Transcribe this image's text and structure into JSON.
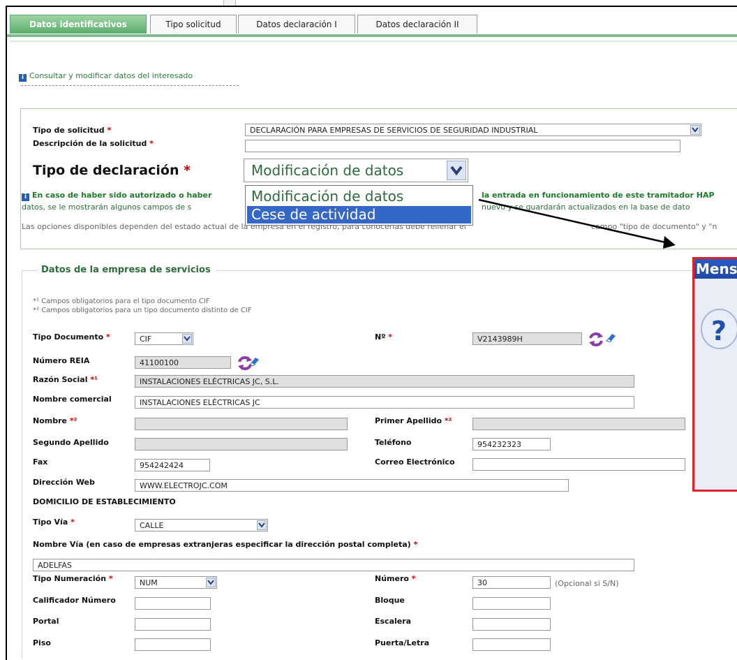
{
  "tabs": [
    {
      "label": "Datos identificativos",
      "active": true
    },
    {
      "label": "Tipo solicitud",
      "active": false
    },
    {
      "label": "Datos declaración I",
      "active": false
    },
    {
      "label": "Datos declaración II",
      "active": false
    }
  ],
  "consult_link": "Consultar y modificar datos del interesado",
  "solicitud": {
    "tipo_label": "Tipo de solicitud",
    "tipo_value": "DECLARACIÓN PARA EMPRESAS DE SERVICIOS DE SEGURIDAD INDUSTRIAL",
    "desc_label": "Descripción de la solicitud",
    "desc_value": "",
    "declaracion_label": "Tipo de declaración",
    "declaracion_value": "Modificación de datos",
    "declaracion_options": [
      "Modificación de datos",
      "Cese de actividad"
    ],
    "info_bold": "En caso de haber sido autorizado o haber",
    "info_bold_2": "la entrada en funcionamiento de este tramitador HAP",
    "info_line2a": "datos, se le mostrarán algunos campos de s",
    "info_line2b": "nuevo y se guardarán actualizados en la base de dato",
    "opciones_text_a": "Las opciones disponibles dependen del estado actual de la empresa en el registro, para conocerlas debe rellenar el",
    "opciones_text_b": "campo \"tipo de documento\" y \"n"
  },
  "empresa": {
    "section_title": "Datos de la empresa de servicios",
    "note1": "*¹ Campos obligatorios para el tipo documento CIF",
    "note2": "*² Campos obligatorios para un tipo documento distinto de CIF",
    "tipo_doc_label": "Tipo Documento",
    "tipo_doc_value": "CIF",
    "numero_label": "Nº",
    "numero_value": "V2143989H",
    "reia_label": "Número REIA",
    "reia_value": "41100100",
    "razon_label": "Razón Social",
    "razon_value": "INSTALACIONES ELÉCTRICAS JC, S.L.",
    "nombre_com_label": "Nombre comercial",
    "nombre_com_value": "INSTALACIONES ELÉCTRICAS JC",
    "nombre_label": "Nombre",
    "primer_apellido_label": "Primer Apellido",
    "segundo_apellido_label": "Segundo Apellido",
    "telefono_label": "Teléfono",
    "telefono_value": "954232323",
    "fax_label": "Fax",
    "fax_value": "954242424",
    "correo_label": "Correo Electrónico",
    "correo_value": "",
    "web_label": "Dirección Web",
    "web_value": "WWW.ELECTROJC.COM",
    "domicilio_label": "DOMICILIO DE ESTABLECIMIENTO",
    "tipo_via_label": "Tipo Vía",
    "tipo_via_value": "CALLE",
    "nombre_via_label": "Nombre Vía (en caso de empresas extranjeras especificar la dirección postal completa)",
    "nombre_via_value": "ADELFAS",
    "tipo_num_label": "Tipo Numeración",
    "tipo_num_value": "NUM",
    "numero2_label": "Número",
    "numero2_value": "30",
    "opcional_text": "(Opcional si S/N)",
    "calificador_label": "Calificador Número",
    "bloque_label": "Bloque",
    "portal_label": "Portal",
    "escalera_label": "Escalera",
    "piso_label": "Piso",
    "puerta_label": "Puerta/Letra",
    "req_mark": "*",
    "req1_mark": "*¹",
    "req2_mark": "*²"
  },
  "popup": {
    "title": "Mens",
    "icon": "question-icon"
  },
  "colors": {
    "accent_green": "#5aae6c",
    "link_green": "#2f7d3f",
    "highlight_blue": "#3567c8",
    "popup_red": "#e0232b"
  }
}
